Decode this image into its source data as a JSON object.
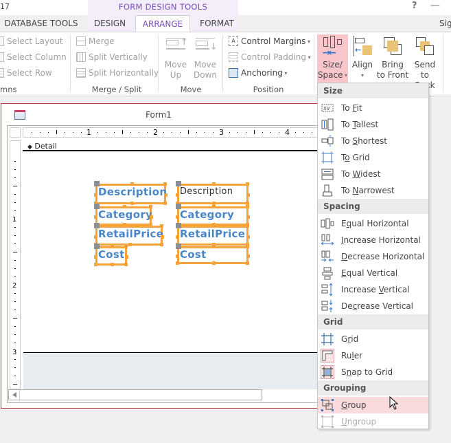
{
  "window": {
    "title_fragment": "17",
    "context_group": "FORM DESIGN TOOLS",
    "help_label": "?",
    "minimize_label": "—",
    "signin_fragment": "Sig"
  },
  "tabs": [
    {
      "label": "DATABASE TOOLS",
      "active": false
    },
    {
      "label": "DESIGN",
      "active": false
    },
    {
      "label": "ARRANGE",
      "active": true
    },
    {
      "label": "FORMAT",
      "active": false
    }
  ],
  "ribbon": {
    "rows_columns": {
      "group_label": "mns",
      "items": [
        "Select Layout",
        "Select Column",
        "Select Row"
      ]
    },
    "merge_split": {
      "group_label": "Merge / Split",
      "items": [
        "Merge",
        "Split Vertically",
        "Split Horizontally"
      ]
    },
    "move": {
      "group_label": "Move",
      "move_up": [
        "Move",
        "Up"
      ],
      "move_down": [
        "Move",
        "Down"
      ]
    },
    "position": {
      "group_label": "Position",
      "control_margins": "Control Margins",
      "control_padding": "Control Padding",
      "anchoring": "Anchoring"
    },
    "sizing": {
      "size_space": [
        "Size/",
        "Space"
      ],
      "align": [
        "Align",
        ""
      ],
      "bring_to_front": [
        "Bring",
        "to Front"
      ],
      "send_to_back": [
        "Send",
        "to Back"
      ]
    }
  },
  "form": {
    "title": "Form1",
    "section_label": "Detail",
    "ruler_h": [
      "1",
      "2",
      "3",
      "4"
    ],
    "ruler_v": [
      "1",
      "2",
      "3"
    ],
    "labels": [
      "Description",
      "Category",
      "RetailPrice",
      "Cost"
    ],
    "fields": [
      "Description",
      "Category",
      "RetailPrice",
      "Cost"
    ]
  },
  "menu": {
    "sections": [
      {
        "header": "Size",
        "items": [
          {
            "pre": "To ",
            "u": "F",
            "post": "it",
            "icon": "to-fit-icon"
          },
          {
            "pre": "To ",
            "u": "T",
            "post": "allest",
            "icon": "to-tallest-icon"
          },
          {
            "pre": "To ",
            "u": "S",
            "post": "hortest",
            "icon": "to-shortest-icon"
          },
          {
            "pre": "T",
            "u": "o",
            "post": " Grid",
            "icon": "to-grid-icon"
          },
          {
            "pre": "To ",
            "u": "W",
            "post": "idest",
            "icon": "to-widest-icon"
          },
          {
            "pre": "To ",
            "u": "N",
            "post": "arrowest",
            "icon": "to-narrowest-icon"
          }
        ]
      },
      {
        "header": "Spacing",
        "items": [
          {
            "pre": "E",
            "u": "q",
            "post": "ual Horizontal",
            "icon": "equal-horizontal-icon"
          },
          {
            "pre": "",
            "u": "I",
            "post": "ncrease Horizontal",
            "icon": "increase-horizontal-icon"
          },
          {
            "pre": "",
            "u": "D",
            "post": "ecrease Horizontal",
            "icon": "decrease-horizontal-icon"
          },
          {
            "pre": "",
            "u": "E",
            "post": "qual Vertical",
            "icon": "equal-vertical-icon"
          },
          {
            "pre": "Increase ",
            "u": "V",
            "post": "ertical",
            "icon": "increase-vertical-icon"
          },
          {
            "pre": "De",
            "u": "c",
            "post": "rease Vertical",
            "icon": "decrease-vertical-icon"
          }
        ]
      },
      {
        "header": "Grid",
        "items": [
          {
            "pre": "G",
            "u": "r",
            "post": "id",
            "icon": "grid-icon"
          },
          {
            "pre": "Ru",
            "u": "l",
            "post": "er",
            "icon": "ruler-icon"
          },
          {
            "pre": "S",
            "u": "n",
            "post": "ap to Grid",
            "icon": "snap-to-grid-icon"
          }
        ]
      },
      {
        "header": "Grouping",
        "items": [
          {
            "pre": "",
            "u": "G",
            "post": "roup",
            "icon": "group-icon",
            "hover": true
          },
          {
            "pre": "",
            "u": "U",
            "post": "ngroup",
            "icon": "ungroup-icon",
            "disabled": true
          }
        ]
      }
    ]
  },
  "colors": {
    "accent_purple": "#7a4bbd",
    "selection_orange": "#f6a43a",
    "label_blue": "#4a86c8",
    "hover_pink": "#f9dadd",
    "pressed_pink": "#f9c6cb"
  }
}
